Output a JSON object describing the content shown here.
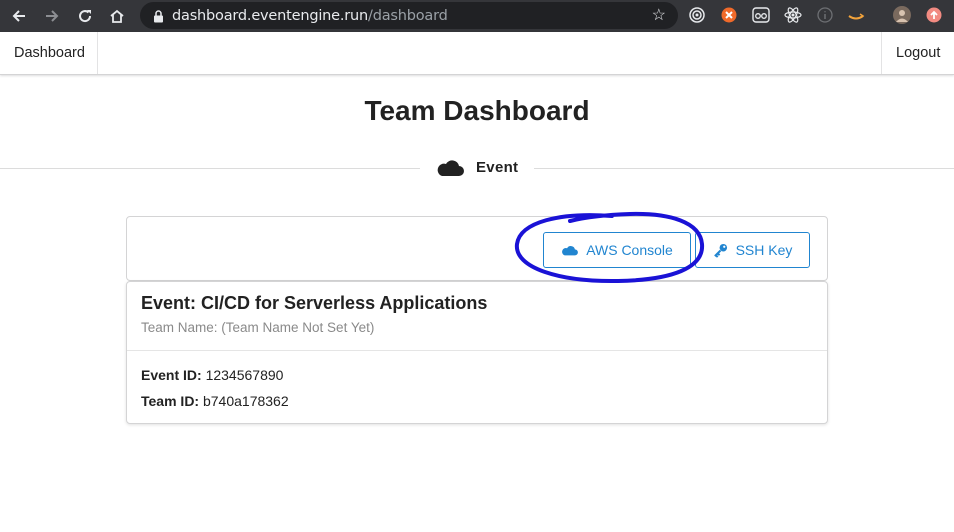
{
  "browser": {
    "url_host": "dashboard.eventengine.run",
    "url_path": "/dashboard",
    "extension_icons": [
      "target-icon",
      "orange-x-icon",
      "glasses-icon",
      "react-icon",
      "info-icon",
      "amazon-icon",
      "profile-avatar",
      "update-icon"
    ]
  },
  "nav": {
    "dashboard_label": "Dashboard",
    "logout_label": "Logout"
  },
  "page": {
    "title": "Team Dashboard",
    "section_label": "Event"
  },
  "buttons": {
    "aws_console": "AWS Console",
    "ssh_key": "SSH Key"
  },
  "event": {
    "title": "Event: CI/CD for Serverless Applications",
    "team_name_line": "Team Name: (Team Name Not Set Yet)",
    "event_id_label": "Event ID:",
    "event_id_value": "1234567890",
    "team_id_label": "Team ID:",
    "team_id_value": "b740a178362"
  },
  "colors": {
    "accent": "#2185d0",
    "annotation": "#1a12d6",
    "chrome": "#35363a"
  }
}
